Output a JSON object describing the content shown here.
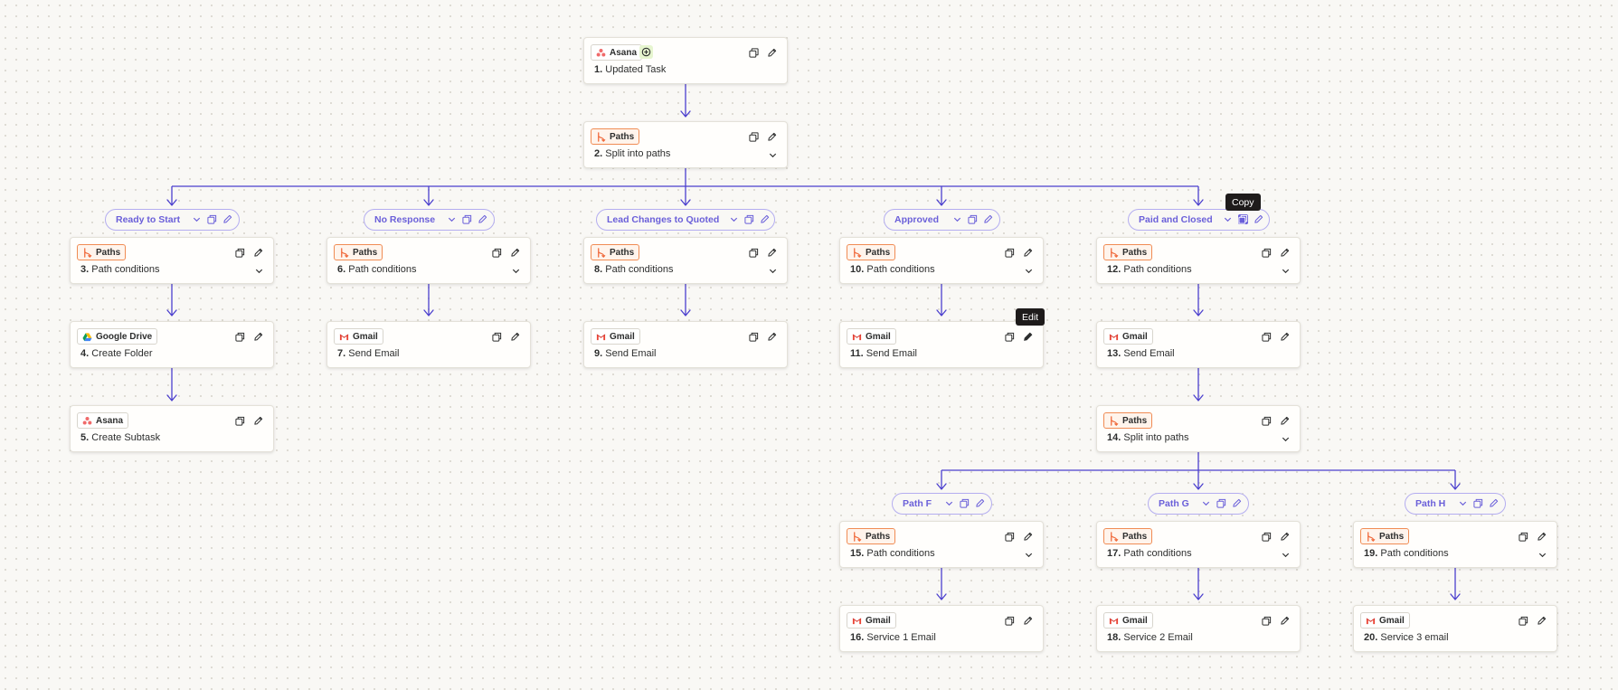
{
  "colors": {
    "connector": "#4b3fce",
    "path_pill_border": "#b4adf0",
    "path_pill_text": "#6a5fd9",
    "paths_badge_border": "#f08c54",
    "paths_badge_bg": "#fff4ec",
    "asana_coral": "#f06a6a",
    "trigger_plus_bg": "#e6f5cf"
  },
  "steps": [
    {
      "num": "1.",
      "title": "Updated Task",
      "app": "Asana",
      "icon": "asana-icon",
      "kind": "trigger"
    },
    {
      "num": "2.",
      "title": "Split into paths",
      "app": "Paths",
      "icon": "paths-icon",
      "kind": "paths"
    },
    {
      "num": "3.",
      "title": "Path conditions",
      "app": "Paths",
      "icon": "paths-icon",
      "kind": "paths"
    },
    {
      "num": "4.",
      "title": "Create Folder",
      "app": "Google Drive",
      "icon": "google-drive-icon",
      "kind": "action"
    },
    {
      "num": "5.",
      "title": "Create Subtask",
      "app": "Asana",
      "icon": "asana-icon",
      "kind": "action"
    },
    {
      "num": "6.",
      "title": "Path conditions",
      "app": "Paths",
      "icon": "paths-icon",
      "kind": "paths"
    },
    {
      "num": "7.",
      "title": "Send Email",
      "app": "Gmail",
      "icon": "gmail-icon",
      "kind": "action"
    },
    {
      "num": "8.",
      "title": "Path conditions",
      "app": "Paths",
      "icon": "paths-icon",
      "kind": "paths"
    },
    {
      "num": "9.",
      "title": "Send Email",
      "app": "Gmail",
      "icon": "gmail-icon",
      "kind": "action"
    },
    {
      "num": "10.",
      "title": "Path conditions",
      "app": "Paths",
      "icon": "paths-icon",
      "kind": "paths"
    },
    {
      "num": "11.",
      "title": "Send Email",
      "app": "Gmail",
      "icon": "gmail-icon",
      "kind": "action"
    },
    {
      "num": "12.",
      "title": "Path conditions",
      "app": "Paths",
      "icon": "paths-icon",
      "kind": "paths"
    },
    {
      "num": "13.",
      "title": "Send Email",
      "app": "Gmail",
      "icon": "gmail-icon",
      "kind": "action"
    },
    {
      "num": "14.",
      "title": "Split into paths",
      "app": "Paths",
      "icon": "paths-icon",
      "kind": "paths"
    },
    {
      "num": "15.",
      "title": "Path conditions",
      "app": "Paths",
      "icon": "paths-icon",
      "kind": "paths"
    },
    {
      "num": "16.",
      "title": "Service 1 Email",
      "app": "Gmail",
      "icon": "gmail-icon",
      "kind": "action"
    },
    {
      "num": "17.",
      "title": "Path conditions",
      "app": "Paths",
      "icon": "paths-icon",
      "kind": "paths"
    },
    {
      "num": "18.",
      "title": "Service 2 Email",
      "app": "Gmail",
      "icon": "gmail-icon",
      "kind": "action"
    },
    {
      "num": "19.",
      "title": "Path conditions",
      "app": "Paths",
      "icon": "paths-icon",
      "kind": "paths"
    },
    {
      "num": "20.",
      "title": "Service 3 email",
      "app": "Gmail",
      "icon": "gmail-icon",
      "kind": "action"
    }
  ],
  "paths": [
    {
      "label": "Ready to Start"
    },
    {
      "label": "No Response"
    },
    {
      "label": "Lead Changes to Quoted"
    },
    {
      "label": "Approved"
    },
    {
      "label": "Paid and Closed"
    },
    {
      "label": "Path F"
    },
    {
      "label": "Path G"
    },
    {
      "label": "Path H"
    }
  ],
  "tooltips": {
    "copy": "Copy",
    "edit": "Edit"
  }
}
